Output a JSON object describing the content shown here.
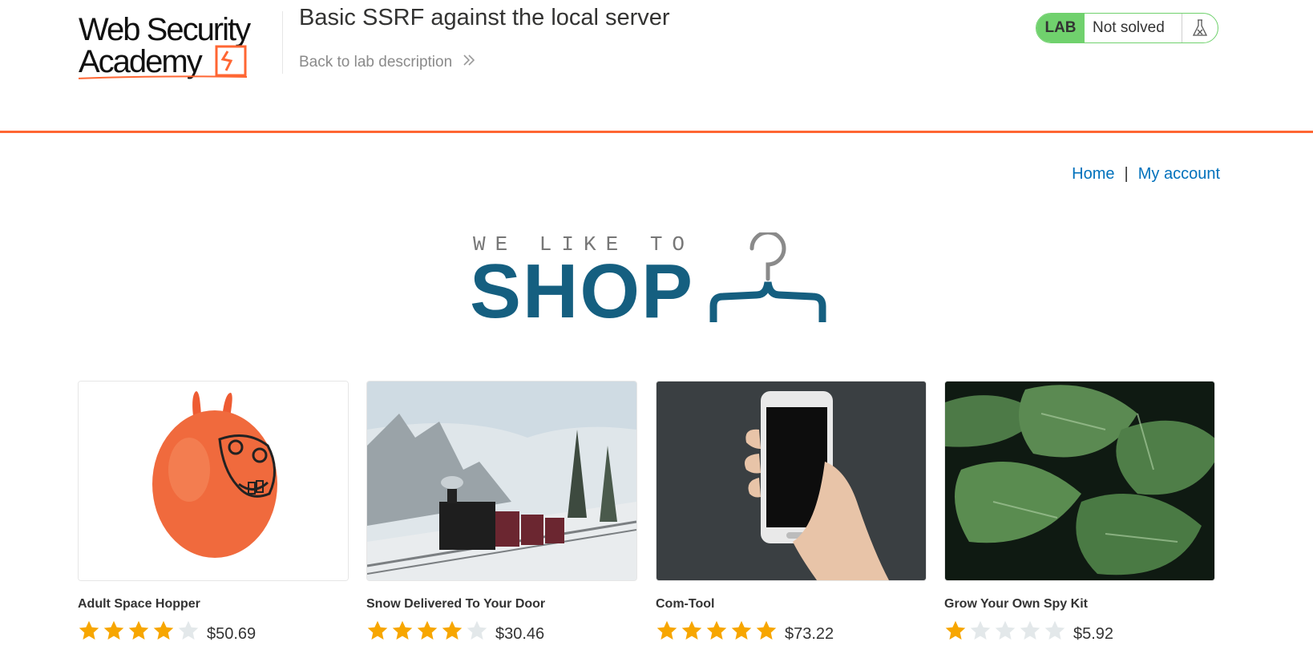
{
  "header": {
    "logo_text_line1": "Web Security",
    "logo_text_line2": "Academy",
    "lab_title": "Basic SSRF against the local server",
    "back_link": "Back to lab description",
    "lab_badge": "LAB",
    "lab_status": "Not solved",
    "accent_color": "#ff6633"
  },
  "nav": {
    "home": "Home",
    "separator": "|",
    "my_account": "My account"
  },
  "banner": {
    "tagline": "WE LIKE TO",
    "shop": "SHOP",
    "icon": "hanger-icon"
  },
  "products": [
    {
      "name": "Adult Space Hopper",
      "rating": 4,
      "price": "$50.69",
      "image": "space-hopper-image"
    },
    {
      "name": "Snow Delivered To Your Door",
      "rating": 4,
      "price": "$30.46",
      "image": "snow-train-image"
    },
    {
      "name": "Com-Tool",
      "rating": 5,
      "price": "$73.22",
      "image": "phone-in-hand-image"
    },
    {
      "name": "Grow Your Own Spy Kit",
      "rating": 1,
      "price": "$5.92",
      "image": "green-leaves-image"
    }
  ],
  "colors": {
    "link": "#0071bc",
    "shop_blue": "#155f80",
    "lab_green": "#70d16d",
    "star_filled": "#f7a600",
    "star_empty": "#e3e8ea"
  }
}
